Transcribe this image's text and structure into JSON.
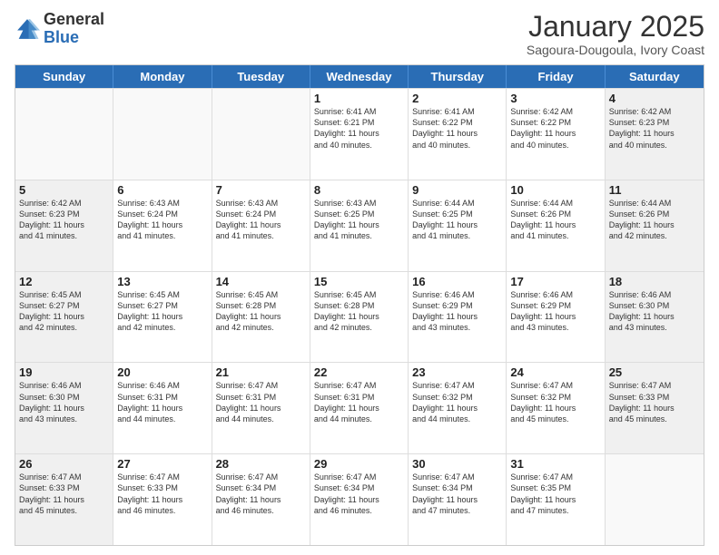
{
  "logo": {
    "general": "General",
    "blue": "Blue"
  },
  "header": {
    "month": "January 2025",
    "location": "Sagoura-Dougoula, Ivory Coast"
  },
  "days": [
    "Sunday",
    "Monday",
    "Tuesday",
    "Wednesday",
    "Thursday",
    "Friday",
    "Saturday"
  ],
  "weeks": [
    [
      {
        "day": "",
        "info": ""
      },
      {
        "day": "",
        "info": ""
      },
      {
        "day": "",
        "info": ""
      },
      {
        "day": "1",
        "info": "Sunrise: 6:41 AM\nSunset: 6:21 PM\nDaylight: 11 hours\nand 40 minutes."
      },
      {
        "day": "2",
        "info": "Sunrise: 6:41 AM\nSunset: 6:22 PM\nDaylight: 11 hours\nand 40 minutes."
      },
      {
        "day": "3",
        "info": "Sunrise: 6:42 AM\nSunset: 6:22 PM\nDaylight: 11 hours\nand 40 minutes."
      },
      {
        "day": "4",
        "info": "Sunrise: 6:42 AM\nSunset: 6:23 PM\nDaylight: 11 hours\nand 40 minutes."
      }
    ],
    [
      {
        "day": "5",
        "info": "Sunrise: 6:42 AM\nSunset: 6:23 PM\nDaylight: 11 hours\nand 41 minutes."
      },
      {
        "day": "6",
        "info": "Sunrise: 6:43 AM\nSunset: 6:24 PM\nDaylight: 11 hours\nand 41 minutes."
      },
      {
        "day": "7",
        "info": "Sunrise: 6:43 AM\nSunset: 6:24 PM\nDaylight: 11 hours\nand 41 minutes."
      },
      {
        "day": "8",
        "info": "Sunrise: 6:43 AM\nSunset: 6:25 PM\nDaylight: 11 hours\nand 41 minutes."
      },
      {
        "day": "9",
        "info": "Sunrise: 6:44 AM\nSunset: 6:25 PM\nDaylight: 11 hours\nand 41 minutes."
      },
      {
        "day": "10",
        "info": "Sunrise: 6:44 AM\nSunset: 6:26 PM\nDaylight: 11 hours\nand 41 minutes."
      },
      {
        "day": "11",
        "info": "Sunrise: 6:44 AM\nSunset: 6:26 PM\nDaylight: 11 hours\nand 42 minutes."
      }
    ],
    [
      {
        "day": "12",
        "info": "Sunrise: 6:45 AM\nSunset: 6:27 PM\nDaylight: 11 hours\nand 42 minutes."
      },
      {
        "day": "13",
        "info": "Sunrise: 6:45 AM\nSunset: 6:27 PM\nDaylight: 11 hours\nand 42 minutes."
      },
      {
        "day": "14",
        "info": "Sunrise: 6:45 AM\nSunset: 6:28 PM\nDaylight: 11 hours\nand 42 minutes."
      },
      {
        "day": "15",
        "info": "Sunrise: 6:45 AM\nSunset: 6:28 PM\nDaylight: 11 hours\nand 42 minutes."
      },
      {
        "day": "16",
        "info": "Sunrise: 6:46 AM\nSunset: 6:29 PM\nDaylight: 11 hours\nand 43 minutes."
      },
      {
        "day": "17",
        "info": "Sunrise: 6:46 AM\nSunset: 6:29 PM\nDaylight: 11 hours\nand 43 minutes."
      },
      {
        "day": "18",
        "info": "Sunrise: 6:46 AM\nSunset: 6:30 PM\nDaylight: 11 hours\nand 43 minutes."
      }
    ],
    [
      {
        "day": "19",
        "info": "Sunrise: 6:46 AM\nSunset: 6:30 PM\nDaylight: 11 hours\nand 43 minutes."
      },
      {
        "day": "20",
        "info": "Sunrise: 6:46 AM\nSunset: 6:31 PM\nDaylight: 11 hours\nand 44 minutes."
      },
      {
        "day": "21",
        "info": "Sunrise: 6:47 AM\nSunset: 6:31 PM\nDaylight: 11 hours\nand 44 minutes."
      },
      {
        "day": "22",
        "info": "Sunrise: 6:47 AM\nSunset: 6:31 PM\nDaylight: 11 hours\nand 44 minutes."
      },
      {
        "day": "23",
        "info": "Sunrise: 6:47 AM\nSunset: 6:32 PM\nDaylight: 11 hours\nand 44 minutes."
      },
      {
        "day": "24",
        "info": "Sunrise: 6:47 AM\nSunset: 6:32 PM\nDaylight: 11 hours\nand 45 minutes."
      },
      {
        "day": "25",
        "info": "Sunrise: 6:47 AM\nSunset: 6:33 PM\nDaylight: 11 hours\nand 45 minutes."
      }
    ],
    [
      {
        "day": "26",
        "info": "Sunrise: 6:47 AM\nSunset: 6:33 PM\nDaylight: 11 hours\nand 45 minutes."
      },
      {
        "day": "27",
        "info": "Sunrise: 6:47 AM\nSunset: 6:33 PM\nDaylight: 11 hours\nand 46 minutes."
      },
      {
        "day": "28",
        "info": "Sunrise: 6:47 AM\nSunset: 6:34 PM\nDaylight: 11 hours\nand 46 minutes."
      },
      {
        "day": "29",
        "info": "Sunrise: 6:47 AM\nSunset: 6:34 PM\nDaylight: 11 hours\nand 46 minutes."
      },
      {
        "day": "30",
        "info": "Sunrise: 6:47 AM\nSunset: 6:34 PM\nDaylight: 11 hours\nand 47 minutes."
      },
      {
        "day": "31",
        "info": "Sunrise: 6:47 AM\nSunset: 6:35 PM\nDaylight: 11 hours\nand 47 minutes."
      },
      {
        "day": "",
        "info": ""
      }
    ]
  ]
}
